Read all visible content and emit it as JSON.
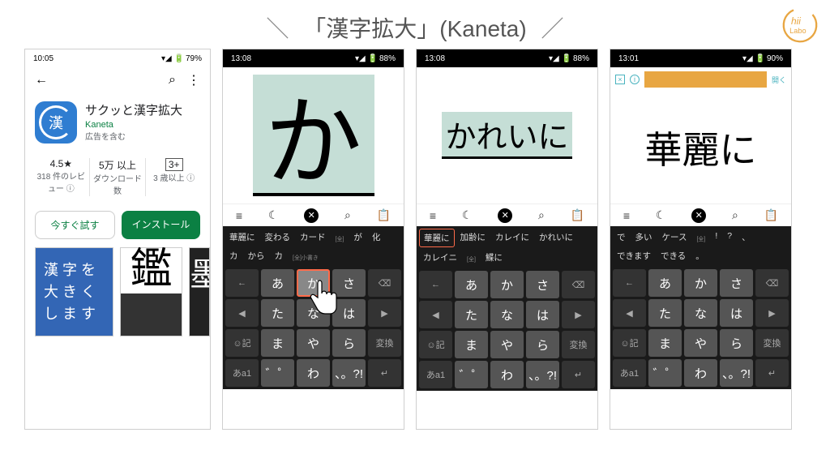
{
  "heading": {
    "slash_left": "＼",
    "title": "「漢字拡大」(Kaneta)",
    "slash_right": "／"
  },
  "logo_text": {
    "c": "C",
    "hi": "hi",
    "labo": "Labo"
  },
  "store": {
    "status_time": "10:05",
    "status_bat": "79%",
    "title": "サクッと漢字拡大",
    "dev": "Kaneta",
    "ads": "広告を含む",
    "rating": "4.5★",
    "reviews": "318 件のレビュー ⓘ",
    "downloads": "5万 以上",
    "downloads_lbl": "ダウンロード数",
    "age_box": "3+",
    "age": "3 歳以上 ⓘ",
    "try": "今すぐ試す",
    "install": "インストール",
    "promo1_l1": "漢 字 を",
    "promo1_l2": "大 き く",
    "promo1_l3": "し ま す",
    "promo2": "鑑",
    "promo3": "墨"
  },
  "shot": {
    "s1": {
      "time": "13:08",
      "bat": "88%",
      "char": "か",
      "sugg": [
        "華麗に",
        "変わる",
        "カード",
        "[全]",
        "が",
        "化",
        "カ",
        "から",
        "カ",
        "[全]小書き"
      ],
      "hl_key": "か"
    },
    "s2": {
      "time": "13:08",
      "bat": "88%",
      "text": "かれいに",
      "sugg": [
        "華麗に",
        "加齢に",
        "カレイに",
        "かれいに",
        "カレイニ",
        "[全]",
        "鰈に"
      ],
      "hl_sugg": 0
    },
    "s3": {
      "time": "13:01",
      "bat": "90%",
      "text": "華麗に",
      "ad_open": "開く",
      "sugg": [
        "で",
        "多い",
        "ケース",
        "[全]",
        "!",
        "?",
        "、",
        "できます",
        "できる",
        "。"
      ]
    }
  },
  "toolbar_icons": [
    "≡",
    "☾",
    "✕",
    "⌕",
    "📋"
  ],
  "kana_rows": [
    [
      "←",
      "あ",
      "か",
      "さ",
      "⌫"
    ],
    [
      "◀",
      "た",
      "な",
      "は",
      "▶"
    ],
    [
      "☺記",
      "ま",
      "や",
      "ら",
      "変換"
    ],
    [
      "あa1",
      "゛゜",
      "わ",
      "、。?!",
      "↵"
    ]
  ]
}
